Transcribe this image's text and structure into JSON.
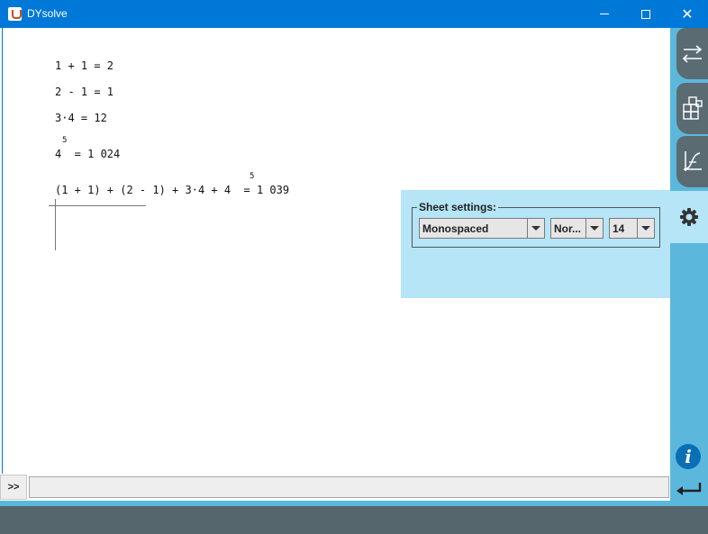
{
  "window": {
    "title": "DYsolve",
    "minimize_label": "",
    "maximize_label": "",
    "close_label": "✕"
  },
  "sheet": {
    "lines": [
      {
        "text": "1 + 1 = 2"
      },
      {
        "text": "2 - 1 = 1"
      },
      {
        "text": "3·4 = 12"
      },
      {
        "text": "4  = 1 024",
        "sup": "5"
      },
      {
        "text": "(1 + 1) + (2 - 1) + 3·4 + 4  = 1 039",
        "sup": "5"
      }
    ]
  },
  "settings": {
    "legend": "Sheet settings:",
    "font": "Monospaced",
    "style": "Nor...",
    "size": "14"
  },
  "command": {
    "prompt": ">>",
    "value": ""
  },
  "sidebar": {
    "info_label": "i"
  },
  "colors": {
    "titlebar": "#0078d7",
    "sidebar": "#5bb8dc",
    "panel": "#b5e5f7",
    "tab": "#5a6b72"
  }
}
